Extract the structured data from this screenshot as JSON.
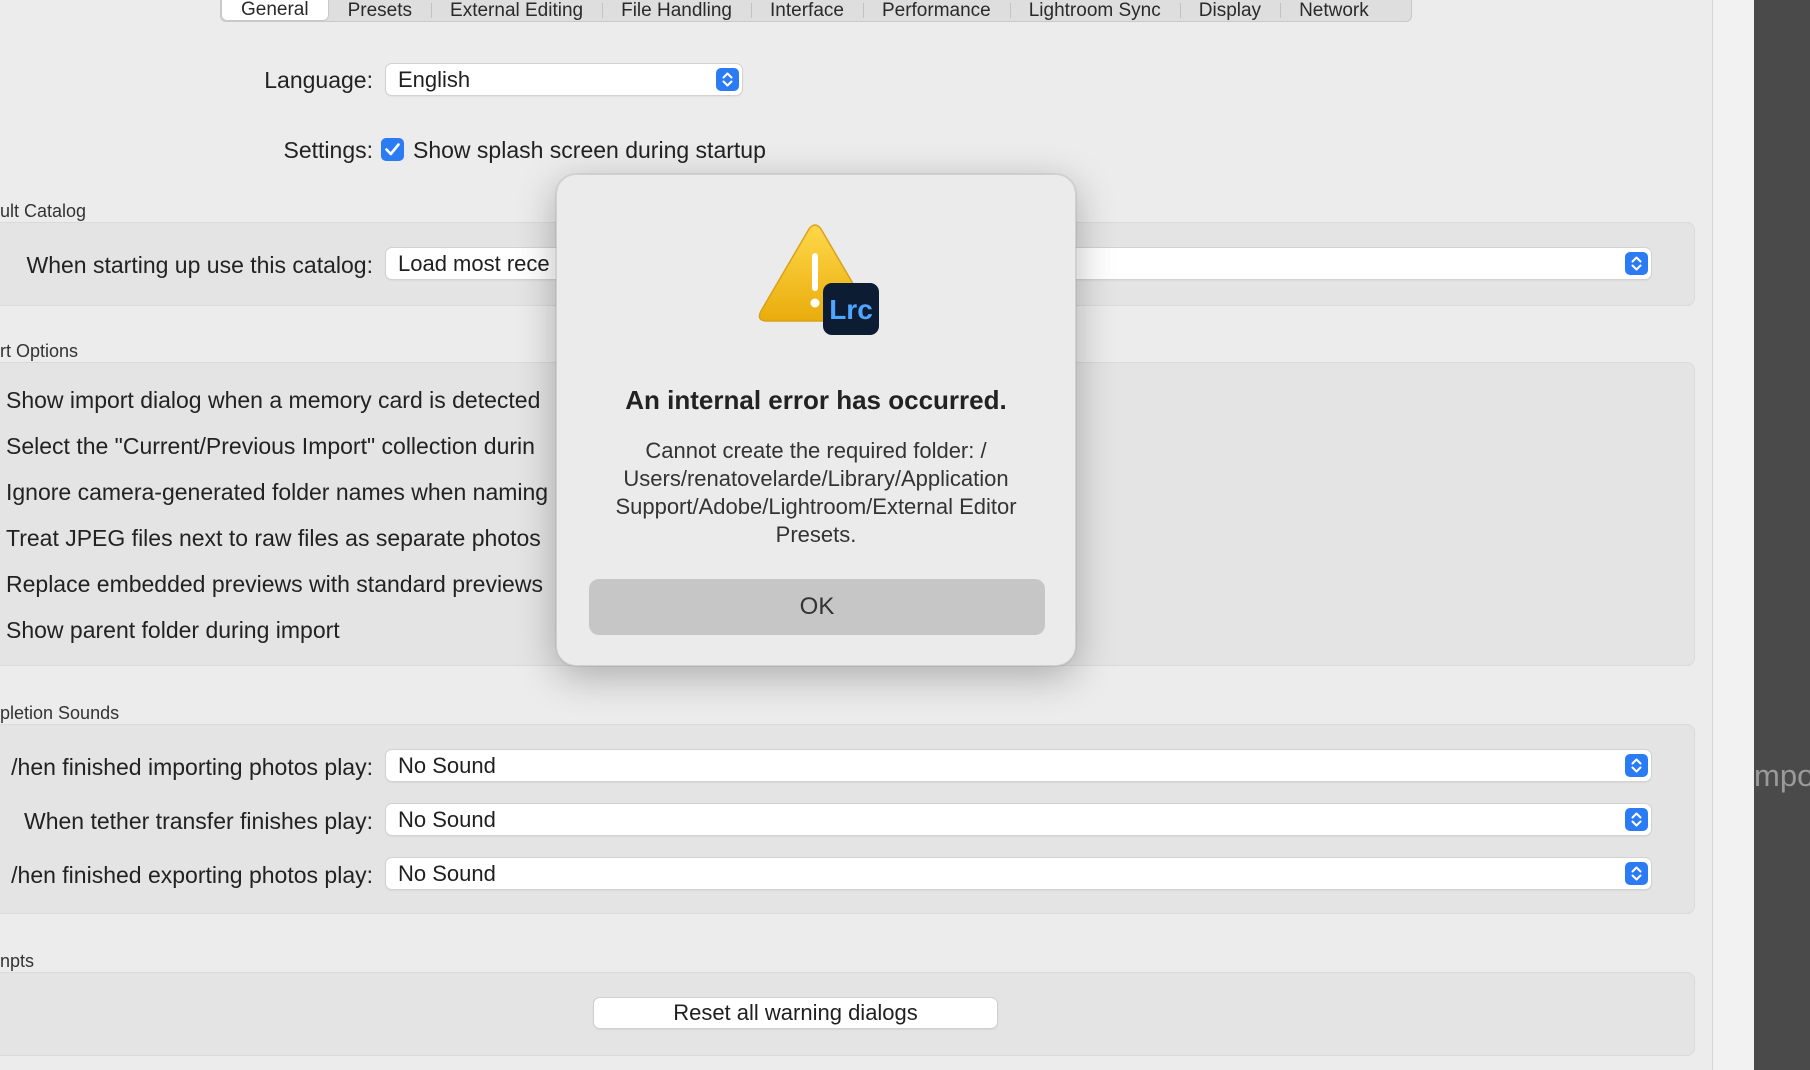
{
  "tabs": [
    "General",
    "Presets",
    "External Editing",
    "File Handling",
    "Interface",
    "Performance",
    "Lightroom Sync",
    "Display",
    "Network"
  ],
  "active_tab": "General",
  "language": {
    "label": "Language:",
    "value": "English"
  },
  "settings": {
    "label": "Settings:",
    "checkbox_label": "Show splash screen during startup",
    "checked": true
  },
  "default_catalog": {
    "section_title": "ult Catalog",
    "label": "When starting up use this catalog:",
    "value": "Load most rece"
  },
  "import_options": {
    "section_title": "rt Options",
    "items": [
      "Show import dialog when a memory card is detected",
      "Select the \"Current/Previous Import\" collection durin",
      "Ignore camera-generated folder names when naming",
      "Treat JPEG files next to raw files as separate photos",
      "Replace embedded previews with standard previews",
      "Show parent folder during import"
    ]
  },
  "completion_sounds": {
    "section_title": "pletion Sounds",
    "rows": [
      {
        "label": "/hen finished importing photos play:",
        "value": "No Sound"
      },
      {
        "label": "When tether transfer finishes play:",
        "value": "No Sound"
      },
      {
        "label": "/hen finished exporting photos play:",
        "value": "No Sound"
      }
    ]
  },
  "prompts": {
    "section_title": "npts",
    "reset_button": "Reset all warning dialogs"
  },
  "side_text": "mpor",
  "dialog": {
    "icon": "warning-triangle-icon",
    "badge_text": "Lrc",
    "title": "An internal error has occurred.",
    "message": "Cannot create the required folder: /\nUsers/renatovelarde/Library/Application\nSupport/Adobe/Lightroom/External Editor\nPresets.",
    "ok_label": "OK"
  },
  "colors": {
    "accent": "#2b7bf5",
    "window_bg": "#ececec",
    "warning_yellow": "#f3c21c",
    "lrc_badge": "#0b1c33",
    "lrc_text": "#4ea6ff"
  }
}
